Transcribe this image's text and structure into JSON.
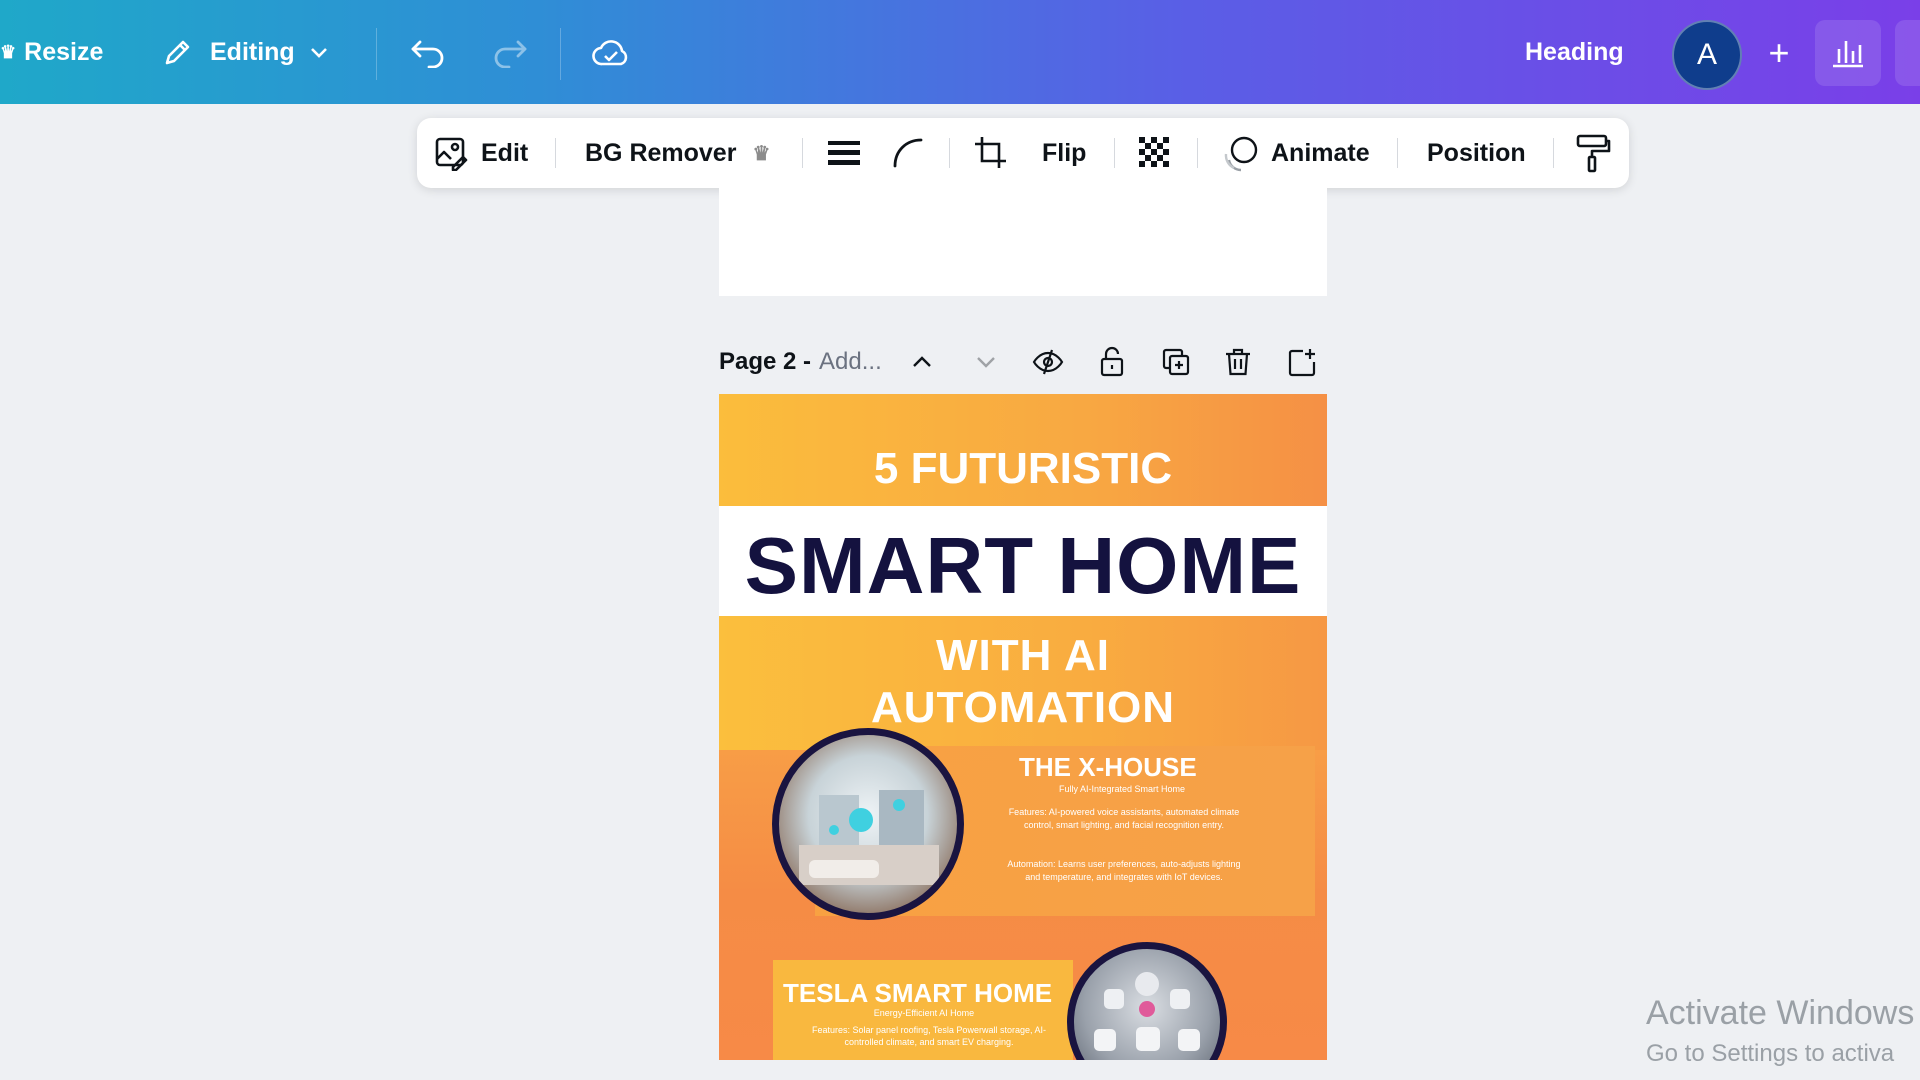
{
  "topbar": {
    "resize_label": "Resize",
    "editing_label": "Editing",
    "heading_label": "Heading",
    "avatar_initial": "A",
    "plus_label": "+"
  },
  "context_toolbar": {
    "edit_label": "Edit",
    "bg_remover_label": "BG Remover",
    "flip_label": "Flip",
    "animate_label": "Animate",
    "position_label": "Position"
  },
  "page2": {
    "label": "Page 2 -",
    "add_title_placeholder": "Add..."
  },
  "poster": {
    "line1": "5 FUTURISTIC",
    "line2": "SMART HOME",
    "line3a": "WITH AI",
    "line3b": "AUTOMATION",
    "item1_title": "THE X-HOUSE",
    "item1_subtitle": "Fully AI-Integrated Smart Home",
    "item1_text1": "Features: AI-powered voice assistants, automated climate control, smart lighting, and facial recognition entry.",
    "item1_text2": "Automation: Learns user preferences, auto-adjusts lighting and temperature, and integrates with IoT devices.",
    "item2_title": "TESLA SMART HOME",
    "item2_subtitle": "Energy-Efficient AI Home",
    "item2_text": "Features: Solar panel roofing, Tesla Powerwall storage, AI-controlled climate, and smart EV charging."
  },
  "watermark": {
    "line1": "Activate Windows",
    "line2": "Go to Settings to activa"
  },
  "colors": {
    "topbar_gradient_start": "#1fa8c9",
    "topbar_gradient_end": "#7a3fe8",
    "poster_orange": "#f78a47",
    "poster_yellow": "#f9c642",
    "poster_navy": "#14123f"
  }
}
